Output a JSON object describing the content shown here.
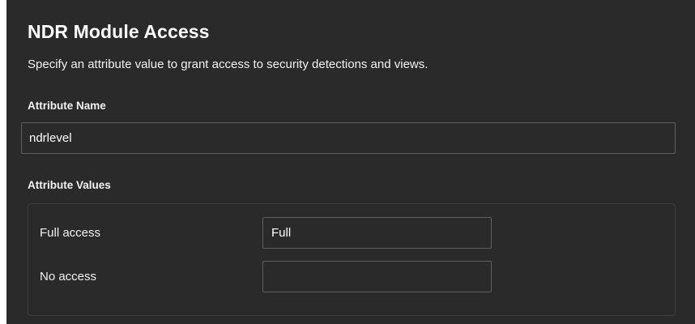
{
  "section": {
    "title": "NDR Module Access",
    "description": "Specify an attribute value to grant access to security detections and views."
  },
  "attribute_name": {
    "label": "Attribute Name",
    "value": "ndrlevel"
  },
  "attribute_values": {
    "label": "Attribute Values",
    "rows": [
      {
        "label": "Full access",
        "value": "Full"
      },
      {
        "label": "No access",
        "value": ""
      }
    ]
  },
  "colors": {
    "panel_background": "#2a2a2a",
    "text": "#ffffff",
    "input_border": "#5f5f5f",
    "group_border": "#3d3d3d"
  }
}
